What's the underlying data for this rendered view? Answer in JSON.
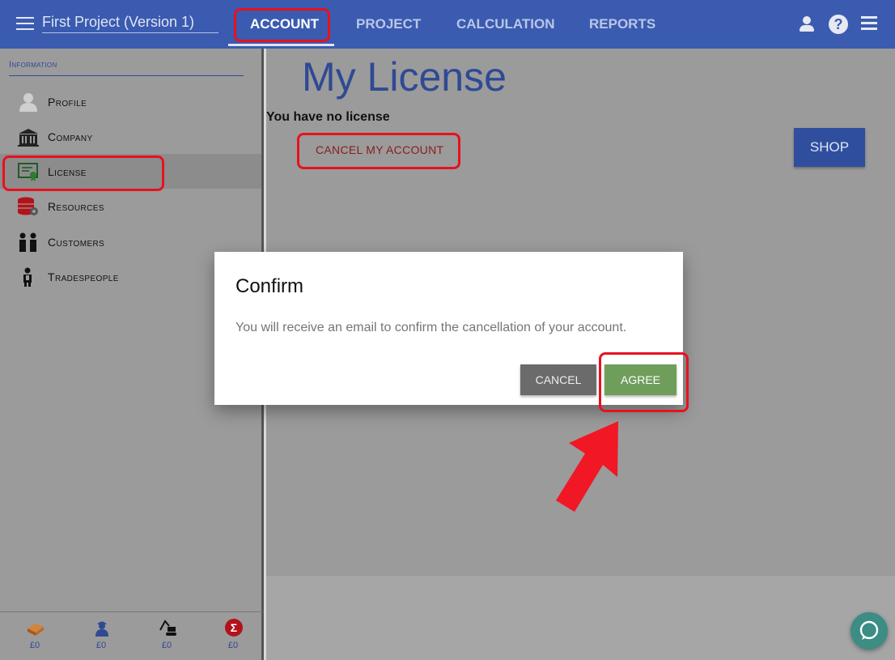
{
  "header": {
    "project_name": "First Project (Version 1)",
    "tabs": [
      {
        "label": "ACCOUNT",
        "active": true
      },
      {
        "label": "PROJECT",
        "active": false
      },
      {
        "label": "CALCULATION",
        "active": false
      },
      {
        "label": "REPORTS",
        "active": false
      }
    ],
    "icons": [
      "menu-icon",
      "user-icon",
      "help-icon",
      "hamburger-icon"
    ],
    "help_glyph": "?"
  },
  "sidebar": {
    "section_label": "Information",
    "items": [
      {
        "label": "Profile",
        "icon": "profile-icon"
      },
      {
        "label": "Company",
        "icon": "company-icon"
      },
      {
        "label": "License",
        "icon": "license-icon",
        "selected": true
      },
      {
        "label": "Resources",
        "icon": "resources-icon"
      },
      {
        "label": "Customers",
        "icon": "customers-icon"
      },
      {
        "label": "Tradespeople",
        "icon": "tradespeople-icon"
      }
    ],
    "costs": [
      {
        "icon": "materials-icon",
        "value": "£0"
      },
      {
        "icon": "labour-icon",
        "value": "£0"
      },
      {
        "icon": "equipment-icon",
        "value": "£0"
      },
      {
        "icon": "total-icon",
        "value": "£0"
      }
    ],
    "sum_glyph": "Σ"
  },
  "main": {
    "title": "My License",
    "status": "You have no license",
    "cancel_account_label": "CANCEL MY ACCOUNT",
    "shop_label": "SHOP"
  },
  "dialog": {
    "title": "Confirm",
    "message": "You will receive an email to confirm the cancellation of your account.",
    "cancel_label": "CANCEL",
    "agree_label": "AGREE"
  },
  "colors": {
    "header": "#3a5bb0",
    "highlight": "#e8111e",
    "agree": "#6f9e5b",
    "shop": "#2f4f9e",
    "chat": "#3c8d84"
  }
}
